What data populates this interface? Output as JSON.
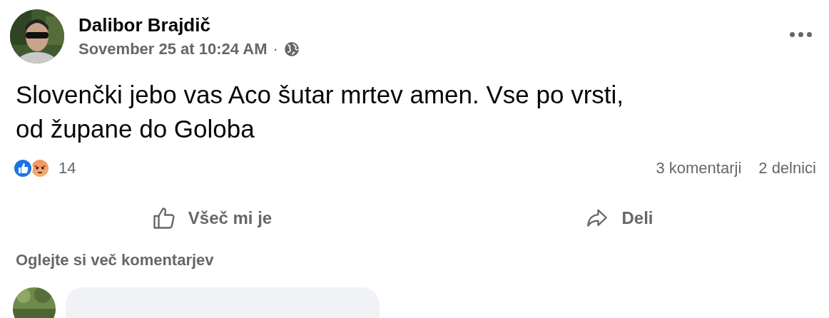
{
  "post": {
    "author": "Dalibor Brajdič",
    "timestamp": "Sovember 25 at 10:24 AM",
    "separator": "·",
    "text_lines": [
      "Slovenčki jebo vas Aco šutar mrtev amen. Vse po vrsti,",
      "od župane do Goloba"
    ],
    "reactions": [
      {
        "kind": "like"
      },
      {
        "kind": "angry"
      }
    ],
    "reaction_count": "14",
    "comments_count": "3 komentarji",
    "shares_count": "2 delnici",
    "actions": [
      {
        "kind": "like",
        "label": "Všeč mi je"
      },
      {
        "kind": "share",
        "label": "Deli"
      }
    ],
    "more_comments": "Oglejte si več komentarjev"
  }
}
